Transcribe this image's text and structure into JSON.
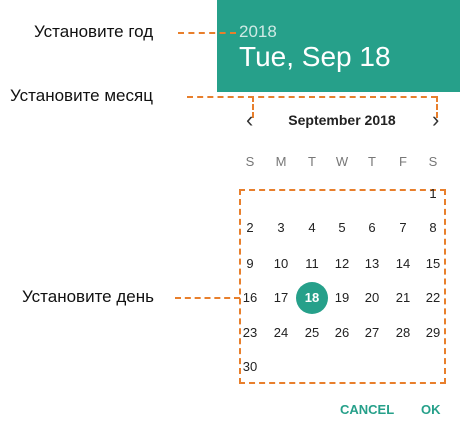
{
  "header": {
    "year": "2018",
    "date": "Tue, Sep 18"
  },
  "annotations": {
    "set_year": "Установите год",
    "set_month": "Установите месяц",
    "set_day": "Установите день"
  },
  "calendar": {
    "prev_icon": "‹",
    "next_icon": "›",
    "month_title": "September 2018",
    "weekdays": [
      "S",
      "M",
      "T",
      "W",
      "T",
      "F",
      "S"
    ],
    "weeks": [
      [
        "",
        "",
        "",
        "",
        "",
        "",
        "1"
      ],
      [
        "2",
        "3",
        "4",
        "5",
        "6",
        "7",
        "8"
      ],
      [
        "9",
        "10",
        "11",
        "12",
        "13",
        "14",
        "15"
      ],
      [
        "16",
        "17",
        "18",
        "19",
        "20",
        "21",
        "22"
      ],
      [
        "23",
        "24",
        "25",
        "26",
        "27",
        "28",
        "29"
      ],
      [
        "30",
        "",
        "",
        "",
        "",
        "",
        ""
      ]
    ],
    "selected_day": "18"
  },
  "actions": {
    "cancel_label": "CANCEL",
    "ok_label": "OK"
  },
  "colors": {
    "accent": "#26a08a",
    "annotation": "#e87f2c"
  }
}
